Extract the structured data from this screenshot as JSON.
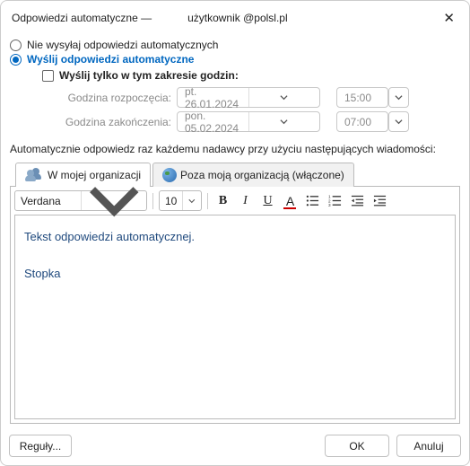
{
  "title": {
    "prefix": "Odpowiedzi automatyczne —",
    "user": "użytkownik @polsl.pl"
  },
  "radios": {
    "dont_send": "Nie wysyłaj odpowiedzi automatycznych",
    "send": "Wyślij odpowiedzi automatyczne"
  },
  "timerange": {
    "checkbox_label": "Wyślij tylko w tym zakresie godzin:",
    "start_label": "Godzina rozpoczęcia:",
    "end_label": "Godzina zakończenia:",
    "start_date": "pt. 26.01.2024",
    "start_time": "15:00",
    "end_date": "pon. 05.02.2024",
    "end_time": "07:00"
  },
  "description": "Automatycznie odpowiedz raz każdemu nadawcy przy użyciu następujących wiadomości:",
  "tabs": {
    "inside": "W mojej organizacji",
    "outside": "Poza moją organizacją (włączone)"
  },
  "toolbar": {
    "font": "Verdana",
    "size": "10",
    "bold": "B",
    "italic": "I",
    "underline": "U",
    "fontcolor": "A"
  },
  "editor": {
    "line1": "Tekst odpowiedzi automatycznej.",
    "line2": "Stopka"
  },
  "footer": {
    "rules": "Reguły...",
    "ok": "OK",
    "cancel": "Anuluj"
  }
}
